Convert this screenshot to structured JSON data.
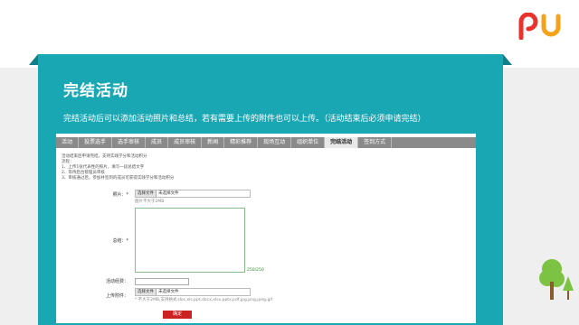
{
  "slide": {
    "title": "完结活动",
    "description": "完结活动后可以添加活动照片和总结，若有需要上传的附件也可以上传。（活动结束后必须申请完结）",
    "colors": {
      "teal": "#1aa7b4",
      "dark_teal": "#107f8a",
      "gray": "#efefef",
      "logo_red": "#e8322b",
      "logo_orange": "#f5a21b",
      "tree_green": "#7cc243"
    },
    "logo_icon": "pu-logo-icon",
    "decor_icon": "tree-icon"
  },
  "app": {
    "tabs": [
      {
        "label": "活动"
      },
      {
        "label": "投票选手"
      },
      {
        "label": "选手审核"
      },
      {
        "label": "成员"
      },
      {
        "label": "成员审核"
      },
      {
        "label": "新闻"
      },
      {
        "label": "精彩推荐"
      },
      {
        "label": "现场互动"
      },
      {
        "label": "组织单位"
      },
      {
        "label": "完结活动",
        "active": true
      },
      {
        "label": "签到方式"
      }
    ],
    "notes": [
      "活动结束后申请完结，支持实践学分和活动积分",
      "流程：",
      "1、上传1张代表性的照片，填写一段总结文字",
      "2、等待后台管理员审核",
      "3、审核通过后，参加并签到的成员可获得实践学分和活动积分"
    ],
    "form": {
      "photo_label": "照片：*",
      "photo_button": "选择文件",
      "photo_status": "未选择文件",
      "photo_hint": "图片不大于2MB",
      "summary_label": "总结：*",
      "summary_counter": "250/250",
      "experience_label": "活动经费：",
      "attachment_label": "上传附件：",
      "attachment_button": "选择文件",
      "attachment_status": "未选择文件",
      "attachment_hint": "* 不大于2MB,支持格式:doc,xls,ppt,docx,xlsx,pptx,pdf,jpg,png,jpeg,gif",
      "submit_label": "确定"
    }
  }
}
